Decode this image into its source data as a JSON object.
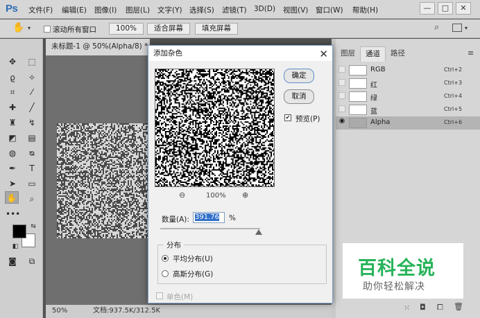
{
  "menubar": {
    "logo": "Ps",
    "items": [
      "文件(F)",
      "编辑(E)",
      "图像(I)",
      "图层(L)",
      "文字(Y)",
      "选择(S)",
      "滤镜(T)",
      "3D(D)",
      "视图(V)",
      "窗口(W)",
      "帮助(H)"
    ],
    "window_controls": {
      "minimize": "—",
      "maximize": "□",
      "close": "✕"
    }
  },
  "optionsbar": {
    "scroll_all_label": "滚动所有窗口",
    "zoom_100": "100%",
    "fit_screen": "适合屏幕",
    "fill_screen": "填充屏幕"
  },
  "document": {
    "tab_title": "未标题-1 @ 50%(Alpha/8) *",
    "status_zoom": "50%",
    "status_doc": "文档:937.5K/312.5K"
  },
  "channels_panel": {
    "tabs": [
      "图层",
      "通道",
      "路径"
    ],
    "active_tab": "通道",
    "channels": [
      {
        "name": "RGB",
        "shortcut": "Ctrl+2"
      },
      {
        "name": "红",
        "shortcut": "Ctrl+3"
      },
      {
        "name": "绿",
        "shortcut": "Ctrl+4"
      },
      {
        "name": "蓝",
        "shortcut": "Ctrl+5"
      },
      {
        "name": "Alpha",
        "shortcut": "Ctrl+6",
        "selected": true
      }
    ]
  },
  "dialog": {
    "title": "添加杂色",
    "ok": "确定",
    "cancel": "取消",
    "preview_label": "预览(P)",
    "preview_checked": true,
    "zoom_level": "100%",
    "amount_label": "数量(A):",
    "amount_value": "391.76",
    "amount_unit": "%",
    "amount_slider_fraction": 0.98,
    "distribution_title": "分布",
    "uniform": "平均分布(U)",
    "gaussian": "高斯分布(G)",
    "selected_distribution": "uniform",
    "monochromatic": "单色(M)"
  },
  "watermark": {
    "title": "百科全说",
    "subtitle": "助你轻松解决"
  },
  "colors": {
    "accent": "#2e6eb5",
    "watermark_green": "#27b35a",
    "selection_blue": "#3270c9"
  }
}
